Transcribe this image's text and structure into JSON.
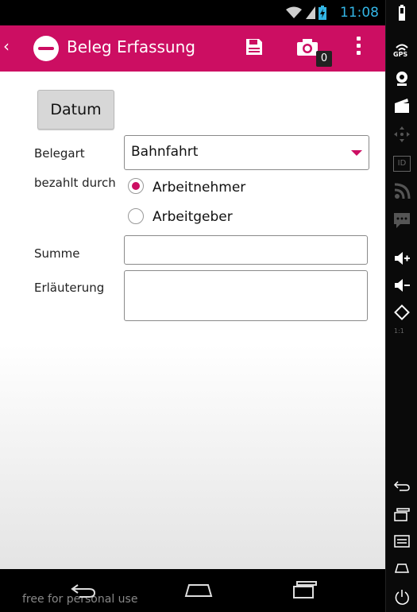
{
  "status": {
    "time": "11:08"
  },
  "actionbar": {
    "title": "Beleg Erfassung",
    "camera_badge": "0"
  },
  "form": {
    "date_button": "Datum",
    "belegart_label": "Belegart",
    "belegart_value": "Bahnfahrt",
    "bezahlt_label": "bezahlt durch",
    "radio_options": [
      "Arbeitnehmer",
      "Arbeitgeber"
    ],
    "radio_selected": "Arbeitnehmer",
    "summe_label": "Summe",
    "erlaeuterung_label": "Erläuterung",
    "summe_value": "",
    "erlaeuterung_value": ""
  },
  "navbar": {
    "watermark": "free for personal use"
  },
  "sidebar": {
    "gps_label": "GPS",
    "id_label": "ID",
    "scale_label": "1:1"
  },
  "colors": {
    "accent": "#cc0e62",
    "status": "#33b5e5"
  }
}
